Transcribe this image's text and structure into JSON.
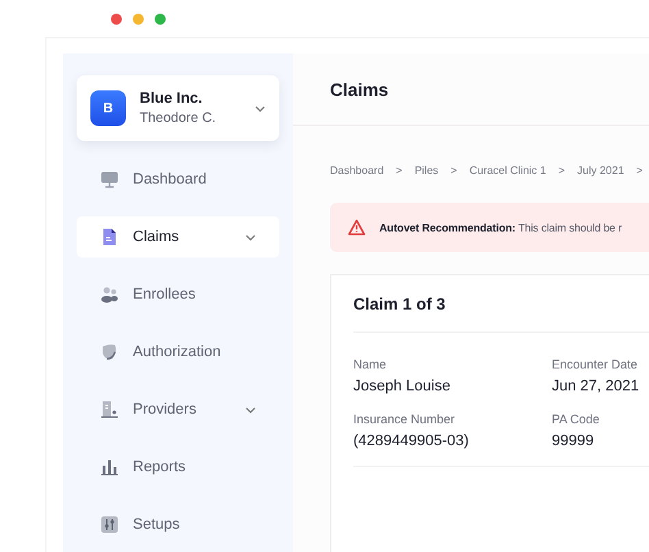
{
  "window": {
    "controls": [
      {
        "color": "#ee4b4b"
      },
      {
        "color": "#f5b731"
      },
      {
        "color": "#2fb84a"
      }
    ]
  },
  "workspace": {
    "initial": "B",
    "name": "Blue Inc.",
    "user": "Theodore C.",
    "expandable": true
  },
  "sidebar": {
    "items": [
      {
        "kind": "dashboard",
        "label": "Dashboard",
        "selected": false,
        "expandable": false
      },
      {
        "kind": "claims",
        "label": "Claims",
        "selected": true,
        "expandable": true
      },
      {
        "kind": "enrollees",
        "label": "Enrollees",
        "selected": false,
        "expandable": false
      },
      {
        "kind": "authorization",
        "label": "Authorization",
        "selected": false,
        "expandable": false
      },
      {
        "kind": "providers",
        "label": "Providers",
        "selected": false,
        "expandable": true
      },
      {
        "kind": "reports",
        "label": "Reports",
        "selected": false,
        "expandable": false
      },
      {
        "kind": "setups",
        "label": "Setups",
        "selected": false,
        "expandable": false
      }
    ]
  },
  "page_title": "Claims",
  "breadcrumb": {
    "separator": ">",
    "items": [
      "Dashboard",
      "Piles",
      "Curacel Clinic 1",
      "July 2021"
    ]
  },
  "alert": {
    "text": "**Autovet Recommendation:** This claim should be r"
  },
  "claim_card": {
    "title": "Claim 1 of 3",
    "fields": [
      {
        "label": "Name",
        "value": "Joseph Louise"
      },
      {
        "label": "Encounter Date",
        "value": "Jun 27, 2021"
      },
      {
        "label": "Insurance Number",
        "value": "(4289449905-03)"
      },
      {
        "label": "PA Code",
        "value": "99999"
      }
    ]
  }
}
